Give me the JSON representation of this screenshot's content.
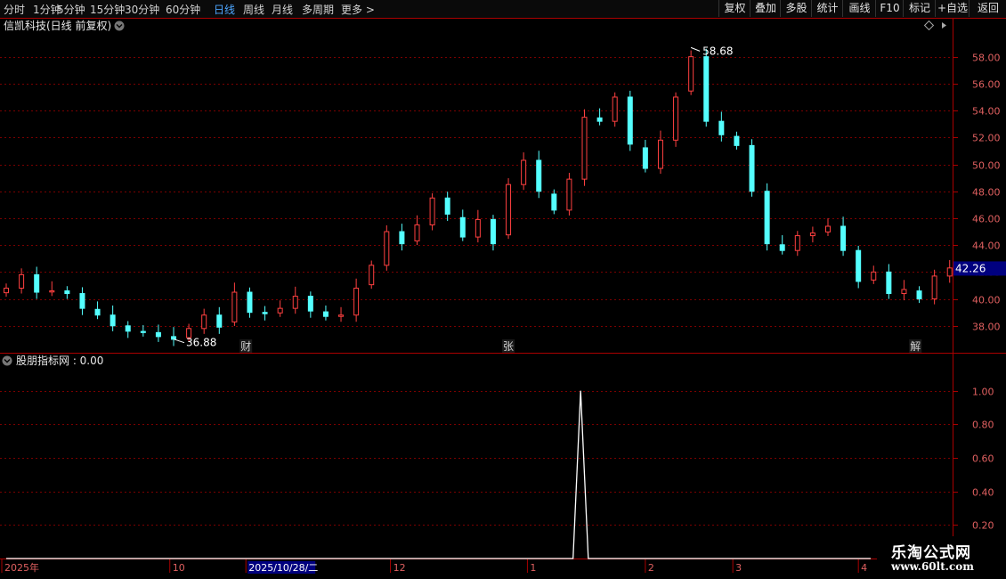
{
  "toolbar": {
    "periods": [
      "分时",
      "1分钟",
      "5分钟",
      "15分钟",
      "30分钟",
      "60分钟",
      "日线",
      "周线",
      "月线",
      "多周期",
      "更多 >"
    ],
    "active_period": "日线",
    "buttons": [
      "复权",
      "叠加",
      "多股",
      "统计",
      "画线",
      "F10",
      "标记",
      "+自选",
      "返回"
    ]
  },
  "main_panel": {
    "title": "信凯科技(日线 前复权)",
    "title_icon": "chevron-down-circle-icon",
    "corner_icon": "diamond-icon",
    "current_price_label": "42.26",
    "high_label": "58.68",
    "low_label": "36.88",
    "event_markers": [
      {
        "text": "财",
        "date_index": 63
      },
      {
        "text": "张",
        "date_index": 132
      },
      {
        "text": "解",
        "date_index": 239
      }
    ]
  },
  "indicator_panel": {
    "title": "股朋指标网 : 0.00",
    "title_icon": "chevron-down-circle-icon"
  },
  "time_axis": {
    "labels": [
      {
        "text": "2025年",
        "date_index": 0
      },
      {
        "text": "10",
        "date_index": 43
      },
      {
        "text": "2025/10/28/二",
        "date_index": 63,
        "highlight": true
      },
      {
        "text": "12",
        "date_index": 101
      },
      {
        "text": "1",
        "date_index": 137
      },
      {
        "text": "2",
        "date_index": 168
      },
      {
        "text": "3",
        "date_index": 191
      },
      {
        "text": "4",
        "date_index": 224
      }
    ]
  },
  "watermark": {
    "title": "乐淘公式网",
    "url": "www.60lt.com"
  },
  "colors": {
    "up": "#ff4040",
    "down": "#54ffff",
    "grid": "#7a0000",
    "axis": "#aa0000",
    "price_tag_bg": "#00007f",
    "date_tag_bg": "#00007f",
    "indicator_line": "#ffffff"
  },
  "chart_data": [
    {
      "type": "candlestick",
      "title": "信凯科技(日线 前复权)",
      "ylim": [
        36.0,
        59.5
      ],
      "yticks": [
        38,
        40,
        42,
        44,
        46,
        48,
        50,
        52,
        54,
        56,
        58
      ],
      "grid": true,
      "x": [
        0,
        4,
        8,
        12,
        16,
        20,
        24,
        28,
        32,
        36,
        40,
        44,
        48,
        52,
        56,
        60,
        64,
        68,
        72,
        76,
        80,
        84,
        88,
        92,
        96,
        100,
        104,
        108,
        112,
        116,
        120,
        124,
        128,
        132,
        136,
        140,
        144,
        148,
        152,
        156,
        160,
        164,
        168,
        172,
        176,
        180,
        184,
        188,
        192,
        196,
        200,
        204,
        208,
        212,
        216,
        220,
        224,
        228,
        232,
        236,
        240,
        244,
        248
      ],
      "close": [
        40.8,
        41.8,
        40.5,
        40.6,
        40.4,
        39.3,
        38.8,
        38.0,
        37.6,
        37.5,
        37.2,
        37.0,
        37.8,
        38.8,
        37.9,
        40.5,
        39.0,
        38.9,
        39.3,
        40.2,
        39.1,
        38.7,
        38.8,
        40.8,
        42.5,
        45.0,
        44.1,
        45.5,
        47.5,
        46.3,
        44.6,
        45.9,
        44.1,
        48.5,
        50.3,
        48.0,
        46.6,
        48.9,
        53.5,
        53.2,
        55.0,
        51.5,
        49.7,
        51.8,
        55.0,
        58.0,
        53.2,
        52.2,
        51.4,
        48.0,
        44.1,
        43.6,
        44.7,
        44.9,
        45.4,
        43.6,
        41.3,
        42.0,
        40.4,
        40.7,
        40.0,
        41.7,
        42.3
      ],
      "ohlc_hint": "open/high/low derived from close in the drawing script"
    },
    {
      "type": "line",
      "title": "股朋指标网 : 0.00",
      "ylim": [
        0,
        1.12
      ],
      "yticks": [
        0.2,
        0.4,
        0.6,
        0.8,
        1.0
      ],
      "x": [
        0,
        147,
        149,
        151,
        153,
        240
      ],
      "y": [
        0,
        0,
        0,
        1.0,
        0,
        0
      ]
    }
  ]
}
